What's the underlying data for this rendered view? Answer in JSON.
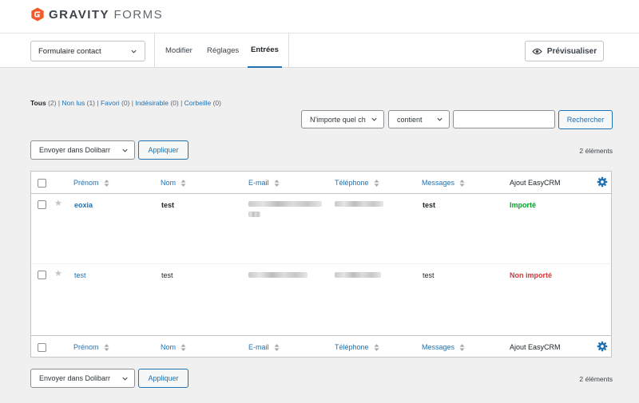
{
  "brand": {
    "name_bold": "GRAVITY",
    "name_thin": "FORMS",
    "accent": "#f15a2b"
  },
  "form_selector": {
    "value": "Formulaire contact"
  },
  "tabs": [
    {
      "label": "Modifier",
      "active": false
    },
    {
      "label": "Réglages",
      "active": false
    },
    {
      "label": "Entrées",
      "active": true
    }
  ],
  "preview_button": {
    "label": "Prévisualiser",
    "icon": "eye-icon"
  },
  "filters": {
    "all": {
      "label": "Tous",
      "count": "(2)"
    },
    "unread": {
      "label": "Non lus",
      "count": "(1)"
    },
    "starred": {
      "label": "Favori",
      "count": "(0)"
    },
    "spam": {
      "label": "Indésirable",
      "count": "(0)"
    },
    "trash": {
      "label": "Corbeille",
      "count": "(0)"
    },
    "separator": "|"
  },
  "search": {
    "field_select": "N'importe quel ch",
    "operator_select": "contient",
    "value": "",
    "button": "Rechercher"
  },
  "bulk_top": {
    "action": "Envoyer dans Dolibarr",
    "apply": "Appliquer",
    "count": "2 éléments"
  },
  "bulk_bottom": {
    "action": "Envoyer dans Dolibarr",
    "apply": "Appliquer",
    "count": "2 éléments"
  },
  "columns": [
    "Prénom",
    "Nom",
    "E-mail",
    "Téléphone",
    "Messages",
    "Ajout EasyCRM"
  ],
  "rows": [
    {
      "prenom": "eoxia",
      "nom": "test",
      "messages": "test",
      "status": "Importé",
      "unread": true
    },
    {
      "prenom": "test",
      "nom": "test",
      "messages": "test",
      "status": "Non importé",
      "unread": false
    }
  ],
  "colors": {
    "link": "#2271b1",
    "imported": "#00a32a",
    "not_imported": "#d63638"
  }
}
